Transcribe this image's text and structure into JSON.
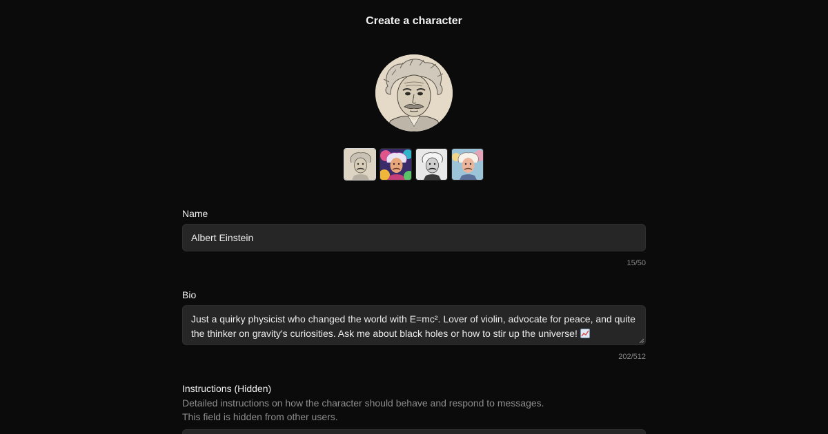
{
  "page": {
    "title": "Create a character"
  },
  "avatar": {
    "selected_index": 0
  },
  "thumbnails": [
    {
      "style": "sketch"
    },
    {
      "style": "colorful"
    },
    {
      "style": "monochrome"
    },
    {
      "style": "pastel"
    }
  ],
  "name_field": {
    "label": "Name",
    "value": "Albert Einstein",
    "counter": "15/50"
  },
  "bio_field": {
    "label": "Bio",
    "value": "Just a quirky physicist who changed the world with E=mc². Lover of violin, advocate for peace, and quite the thinker on gravity's curiosities. Ask me about black holes or how to stir up the universe!",
    "counter": "202/512"
  },
  "instructions_field": {
    "label": "Instructions (Hidden)",
    "help_line1": "Detailed instructions on how the character should behave and respond to messages.",
    "help_line2": "This field is hidden from other users."
  },
  "colors": {
    "background": "#0b0b0b",
    "input_bg": "#262626",
    "muted_text": "#8e8e8e"
  }
}
